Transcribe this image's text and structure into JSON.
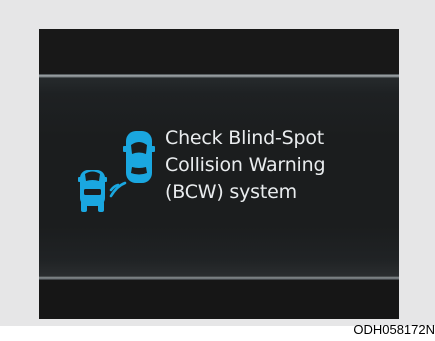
{
  "display": {
    "message_lines": [
      "Check Blind-Spot",
      "Collision Warning",
      "(BCW) system"
    ],
    "icon": "blind-spot-collision-warning-icon",
    "text_color": "#e9ecee",
    "icon_color": "#1aa7e0"
  },
  "caption": {
    "code": "ODH058172N"
  }
}
